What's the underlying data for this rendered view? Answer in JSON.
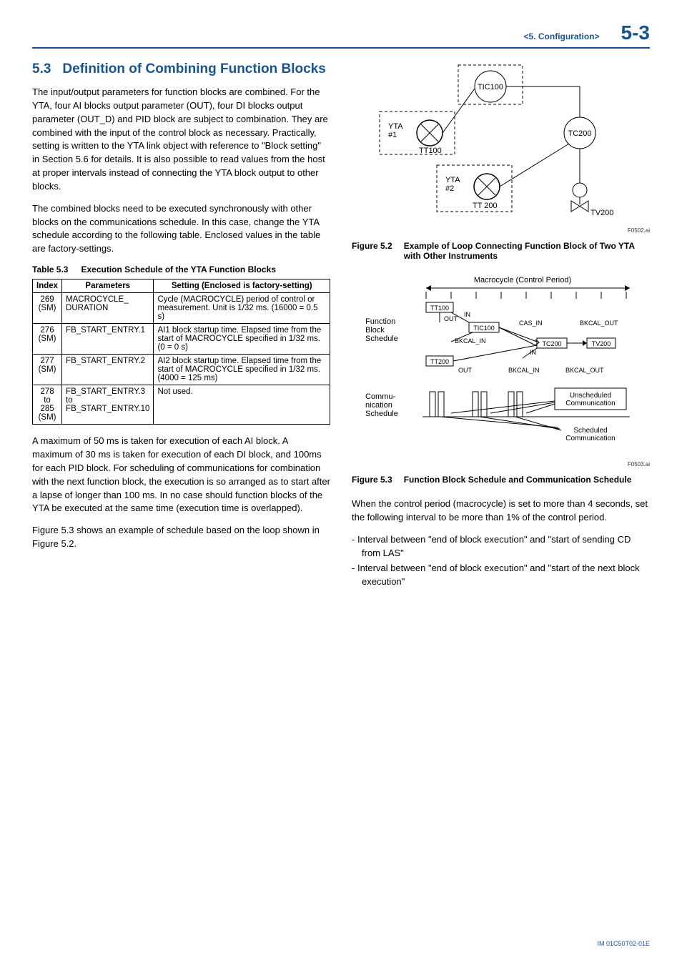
{
  "header": {
    "section": "<5.  Configuration>",
    "page": "5-3"
  },
  "left": {
    "section_num": "5.3",
    "section_title": "Definition of Combining Function Blocks",
    "para1": "The input/output parameters for function blocks are combined. For the YTA, four AI blocks output parameter (OUT), four DI blocks output parameter (OUT_D) and PID block are subject to combination. They are combined with the input of the control block as necessary. Practically, setting is written to the YTA link object with reference to \"Block setting\" in Section 5.6 for details. It is also possible to read values from the host at proper intervals instead of connecting the YTA block output to other blocks.",
    "para2": "The combined blocks need to be executed synchronously with other blocks on the communications schedule. In this case, change the YTA schedule according to the following table. Enclosed values in the table are factory-settings.",
    "table_caption_num": "Table 5.3",
    "table_caption_title": "Execution Schedule of the YTA Function Blocks",
    "table": {
      "headers": [
        "Index",
        "Parameters",
        "Setting (Enclosed is factory-setting)"
      ],
      "rows": [
        {
          "index": "269\n(SM)",
          "param": "MACROCYCLE_\nDURATION",
          "setting": "Cycle (MACROCYCLE) period of control or measurement. Unit is 1/32 ms. (16000 = 0.5 s)"
        },
        {
          "index": "276\n(SM)",
          "param": "FB_START_ENTRY.1",
          "setting": "AI1 block startup time. Elapsed time from the start of MACROCYCLE specified in 1/32 ms. (0 = 0 s)"
        },
        {
          "index": "277\n(SM)",
          "param": "FB_START_ENTRY.2",
          "setting": "AI2 block startup time. Elapsed time from the start of MACROCYCLE specified in 1/32 ms. (4000 = 125 ms)"
        },
        {
          "index": "278\nto\n285\n(SM)",
          "param": "FB_START_ENTRY.3\nto\nFB_START_ENTRY.10",
          "setting": "Not used."
        }
      ]
    },
    "para3": "A maximum of 50 ms is taken for execution of each AI block. A maximum of 30 ms is taken for execution of each DI block, and 100ms for each PID block. For scheduling of communications for combination with the next function block, the execution is so arranged as to start after a lapse of longer than 100 ms. In no case should function blocks of the YTA be executed at the same time (execution time is overlapped).",
    "para4": "Figure 5.3 shows an example of schedule based on the loop shown in Figure 5.2."
  },
  "right": {
    "fig52": {
      "num": "Figure 5.2",
      "title": "Example of Loop Connecting Function Block of Two YTA with Other Instruments",
      "ai": "F0502.ai",
      "labels": {
        "tic100": "TIC100",
        "yta1": "YTA\n#1",
        "tt100": "TT100",
        "tc200": "TC200",
        "yta2": "YTA\n#2",
        "tt200": "TT 200",
        "tv200": "TV200"
      }
    },
    "fig53": {
      "num": "Figure 5.3",
      "title": "Function Block Schedule and Communication Schedule",
      "ai": "F0503.ai",
      "labels": {
        "macrocycle": "Macrocycle (Control Period)",
        "fbs": "Function\nBlock\nSchedule",
        "cs": "Commu-\nnication\nSchedule",
        "tt100": "TT100",
        "out1": "OUT",
        "in1": "IN",
        "tic100": "TIC100",
        "casin": "CAS_IN",
        "bkcalin1": "BKCAL_IN",
        "bkcalout1": "BKCAL_OUT",
        "tc200": "TC200",
        "tv200": "TV200",
        "in2": "IN",
        "tt200": "TT200",
        "out2": "OUT",
        "bkcalin2": "BKCAL_IN",
        "bkcalout2": "BKCAL_OUT",
        "unsched": "Unscheduled\nCommunication",
        "sched": "Scheduled\nCommunication"
      }
    },
    "para_after_fig": "When the control period (macrocycle) is set to more than 4 seconds, set the following interval to be more than 1% of the control period.",
    "bullets": [
      "Interval between \"end of block execution\" and \"start of sending CD from LAS\"",
      "Interval between \"end of block execution\" and \"start of the next block execution\""
    ]
  },
  "footer_doc": "IM 01C50T02-01E"
}
